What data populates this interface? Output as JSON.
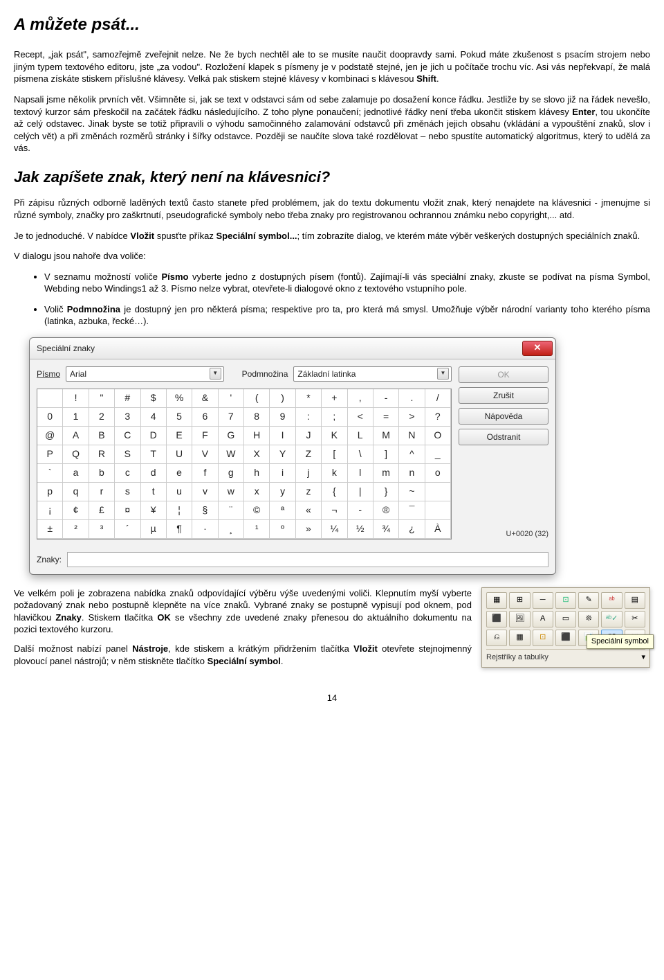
{
  "h1": "A můžete psát...",
  "p1_a": "Recept, „jak psát\", samozřejmě zveřejnit nelze. Ne že bych nechtěl ale to se musíte naučit doopravdy sami. Pokud máte zkušenost s psacím strojem nebo jiným typem textového editoru, jste „za vodou\". Rozložení klapek s písmeny je v podstatě stejné, jen je jich u počítače trochu víc. Asi vás nepřekvapí, že malá písmena získáte stiskem příslušné klávesy. Velká pak stiskem stejné klávesy v kombinaci s klávesou ",
  "p1_b": "Shift",
  "p1_c": ".",
  "p2_a": "Napsali jsme několik prvních vět. Všimněte si, jak se text v odstavci sám od sebe zalamuje po dosažení konce řádku. Jestliže by se slovo již na řádek nevešlo, textový kurzor sám přeskočil na začátek řádku následujícího. Z toho plyne ponaučení; jednotlivé řádky není třeba ukončit stiskem klávesy ",
  "p2_b": "Enter",
  "p2_c": ", tou ukončíte až celý odstavec. Jinak byste se totiž připravili o výhodu samočinného zalamování odstavců při změnách jejich obsahu (vkládání a vypouštění znaků, slov i celých vět) a při změnách rozměrů stránky i šířky odstavce. Později se naučíte slova také rozdělovat – nebo spustíte automatický algoritmus, který to udělá za vás.",
  "h2": "Jak zapíšete znak, který není na klávesnici?",
  "p3": "Při zápisu různých odborně laděných textů často stanete před problémem, jak do textu dokumentu vložit znak, který nenajdete na klávesnici - jmenujme si různé symboly, značky pro zaškrtnutí, pseudografické symboly nebo třeba znaky pro registrovanou ochrannou známku nebo copyright,... atd.",
  "p4_a": "Je to jednoduché. V nabídce ",
  "p4_b": "Vložit",
  "p4_c": " spusťte příkaz ",
  "p4_d": "Speciální symbol...",
  "p4_e": "; tím zobrazíte dialog, ve kterém máte výběr veškerých dostupných speciálních znaků.",
  "p5": "V dialogu jsou nahoře dva voliče:",
  "li1_a": "V seznamu možností voliče ",
  "li1_b": "Písmo",
  "li1_c": " vyberte jedno z dostupných písem (fontů). Zajímají-li vás speciální znaky, zkuste se podívat na písma Symbol, Webding nebo Windings1 až 3. Písmo nelze vybrat, otevřete-li dialogové okno z textového vstupního pole.",
  "li2_a": "Volič ",
  "li2_b": "Podmnožina",
  "li2_c": " je dostupný jen pro některá písma; respektive pro ta, pro která má smysl. Umožňuje výběr národní varianty toho kterého písma (latinka, azbuka, řecké…).",
  "dialog": {
    "title": "Speciální znaky",
    "close": "✕",
    "font_label": "Písmo",
    "font_value": "Arial",
    "subset_label": "Podmnožina",
    "subset_value": "Základní latinka",
    "buttons": {
      "ok": "OK",
      "cancel": "Zrušit",
      "help": "Nápověda",
      "delete": "Odstranit"
    },
    "codepoint": "U+0020 (32)",
    "znaky_label": "Znaky:",
    "grid": [
      " ",
      "!",
      "\"",
      "#",
      "$",
      "%",
      "&",
      "'",
      "(",
      ")",
      "*",
      "+",
      ",",
      "-",
      ".",
      "/",
      "0",
      "1",
      "2",
      "3",
      "4",
      "5",
      "6",
      "7",
      "8",
      "9",
      ":",
      ";",
      "<",
      "=",
      ">",
      "?",
      "@",
      "A",
      "B",
      "C",
      "D",
      "E",
      "F",
      "G",
      "H",
      "I",
      "J",
      "K",
      "L",
      "M",
      "N",
      "O",
      "P",
      "Q",
      "R",
      "S",
      "T",
      "U",
      "V",
      "W",
      "X",
      "Y",
      "Z",
      "[",
      "\\",
      "]",
      "^",
      "_",
      "`",
      "a",
      "b",
      "c",
      "d",
      "e",
      "f",
      "g",
      "h",
      "i",
      "j",
      "k",
      "l",
      "m",
      "n",
      "o",
      "p",
      "q",
      "r",
      "s",
      "t",
      "u",
      "v",
      "w",
      "x",
      "y",
      "z",
      "{",
      "|",
      "}",
      "~",
      " ",
      "¡",
      "¢",
      "£",
      "¤",
      "¥",
      "¦",
      "§",
      "¨",
      "©",
      "ª",
      "«",
      "¬",
      "-",
      "®",
      "¯",
      " ",
      "±",
      "²",
      "³",
      "´",
      "µ",
      "¶",
      "·",
      "¸",
      "¹",
      "º",
      "»",
      "¼",
      "½",
      "¾",
      "¿",
      "À"
    ]
  },
  "p6_a": "Ve velkém poli je zobrazena nabídka znaků odpovídající výběru výše uvedenými voliči. Klepnutím myší vyberte požadovaný znak nebo postupně klepněte na více znaků. Vybrané znaky se postupně vypisují pod oknem, pod hlavičkou ",
  "p6_b": "Znaky",
  "p6_c": ". Stiskem tlačítka ",
  "p6_d": "OK",
  "p6_e": " se všechny zde uvedené znaky přenesou do aktuálního dokumentu na pozici textového kurzoru.",
  "p7_a": "Další možnost nabízí panel ",
  "p7_b": "Nástroje",
  "p7_c": ", kde stiskem a krátkým přidržením tlačítka ",
  "p7_d": "Vložit",
  "p7_e": " otevřete stejnojmenný plovoucí panel nástrojů; v něm stiskněte tlačítko ",
  "p7_f": "Speciální symbol",
  "p7_g": ".",
  "toolbar": {
    "tooltip": "Speciální symbol",
    "footer": "Rejstříky a tabulky",
    "arrow": "▾"
  },
  "page_num": "14"
}
